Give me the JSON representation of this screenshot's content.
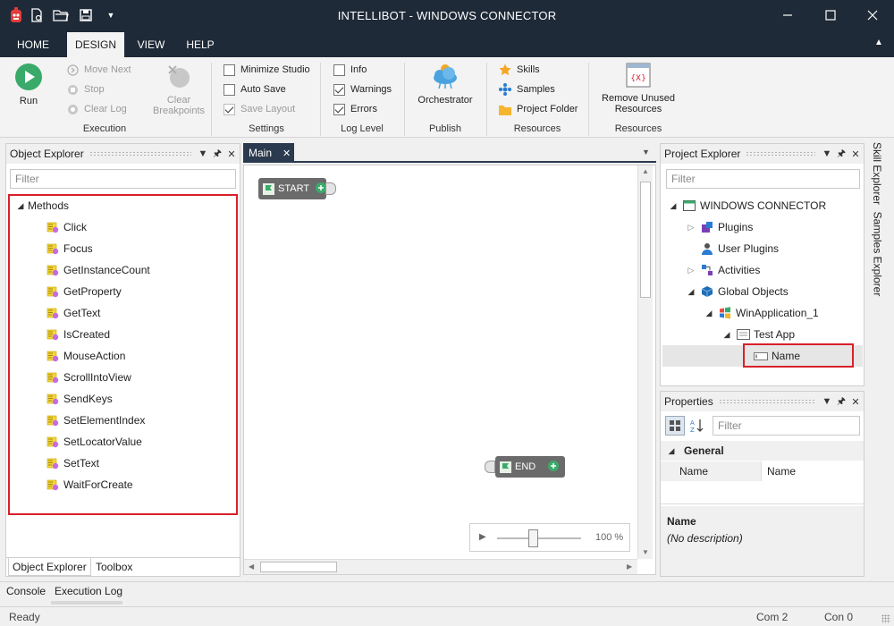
{
  "window": {
    "title": "INTELLIBOT - WINDOWS CONNECTOR"
  },
  "ribbon_tabs": [
    "HOME",
    "DESIGN",
    "VIEW",
    "HELP"
  ],
  "ribbon": {
    "execution": {
      "run": "Run",
      "move_next": "Move Next",
      "stop": "Stop",
      "clear_log": "Clear Log",
      "clear_breakpoints": "Clear Breakpoints",
      "label": "Execution"
    },
    "settings": {
      "minimize_studio": "Minimize Studio",
      "auto_save": "Auto Save",
      "save_layout": "Save Layout",
      "label": "Settings"
    },
    "log_level": {
      "info": "Info",
      "warnings": "Warnings",
      "errors": "Errors",
      "label": "Log Level"
    },
    "publish": {
      "orchestrator": "Orchestrator",
      "label": "Publish"
    },
    "resources1": {
      "skills": "Skills",
      "samples": "Samples",
      "project_folder": "Project Folder",
      "label": "Resources"
    },
    "resources2": {
      "remove_unused": "Remove Unused Resources",
      "label": "Resources"
    }
  },
  "object_explorer": {
    "title": "Object Explorer",
    "filter_placeholder": "Filter",
    "root": "Methods",
    "methods": [
      "Click",
      "Focus",
      "GetInstanceCount",
      "GetProperty",
      "GetText",
      "IsCreated",
      "MouseAction",
      "ScrollIntoView",
      "SendKeys",
      "SetElementIndex",
      "SetLocatorValue",
      "SetText",
      "WaitForCreate"
    ],
    "tabs": [
      "Object Explorer",
      "Toolbox"
    ]
  },
  "designer": {
    "tab": "Main",
    "start": "START",
    "end": "END",
    "zoom": "100 %"
  },
  "project_explorer": {
    "title": "Project Explorer",
    "filter_placeholder": "Filter",
    "root": "WINDOWS CONNECTOR",
    "plugins": "Plugins",
    "user_plugins": "User Plugins",
    "activities": "Activities",
    "global_objects": "Global Objects",
    "win_app": "WinApplication_1",
    "test_app": "Test App",
    "name_node": "Name"
  },
  "side_tabs": [
    "Skill Explorer",
    "Samples Explorer"
  ],
  "properties": {
    "title": "Properties",
    "filter_placeholder": "Filter",
    "category": "General",
    "prop_name": "Name",
    "prop_value": "Name",
    "desc_title": "Name",
    "desc_text": "(No description)"
  },
  "bottom_tabs": [
    "Console",
    "Execution Log"
  ],
  "status": {
    "left": "Ready",
    "com": "Com 2",
    "con": "Con 0"
  },
  "colors": {
    "titlebar": "#1f2a38",
    "accent_green": "#3aaa6a",
    "highlight_red": "#d9202a"
  }
}
